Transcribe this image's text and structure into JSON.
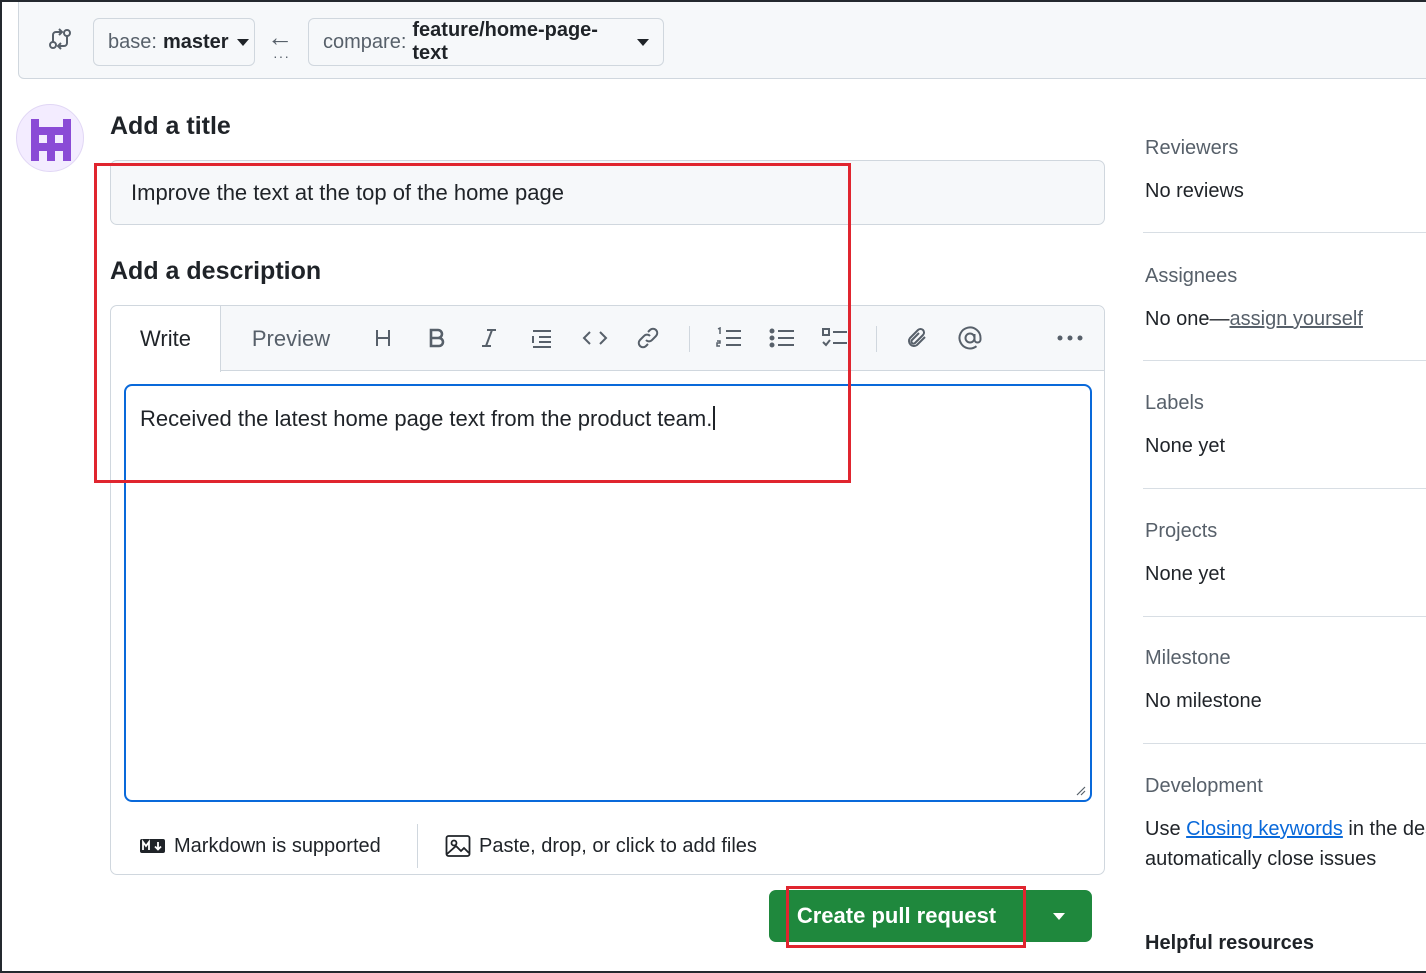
{
  "compare_bar": {
    "base_prefix": "base:",
    "base_value": "master",
    "compare_prefix": "compare:",
    "compare_value": "feature/home-page-text"
  },
  "form": {
    "title_heading": "Add a title",
    "title_value": "Improve the text at the top of the home page",
    "description_heading": "Add a description"
  },
  "editor": {
    "tab_write": "Write",
    "tab_preview": "Preview",
    "body": "Received the latest home page text from the product team.",
    "markdown_note": "Markdown is supported",
    "attach_note": "Paste, drop, or click to add files",
    "toolbar": [
      "heading-icon",
      "bold-icon",
      "italic-icon",
      "quote-icon",
      "code-icon",
      "link-icon",
      "ordered-list-icon",
      "unordered-list-icon",
      "task-list-icon",
      "attach-icon",
      "mention-icon",
      "more-icon"
    ]
  },
  "actions": {
    "create_label": "Create pull request"
  },
  "sidebar": {
    "reviewers_title": "Reviewers",
    "reviewers_value": "No reviews",
    "assignees_title": "Assignees",
    "assignees_value": "No one—",
    "assignees_link": "assign yourself",
    "labels_title": "Labels",
    "labels_value": "None yet",
    "projects_title": "Projects",
    "projects_value": "None yet",
    "milestone_title": "Milestone",
    "milestone_value": "No milestone",
    "development_title": "Development",
    "development_pre": "Use ",
    "development_link": "Closing keywords",
    "development_post": " in the des",
    "development_line2": "automatically close issues",
    "helpful_title": "Helpful resources"
  },
  "colors": {
    "accent_blue": "#0969da",
    "primary_green": "#1f883d",
    "highlight_red": "#e0252f"
  }
}
